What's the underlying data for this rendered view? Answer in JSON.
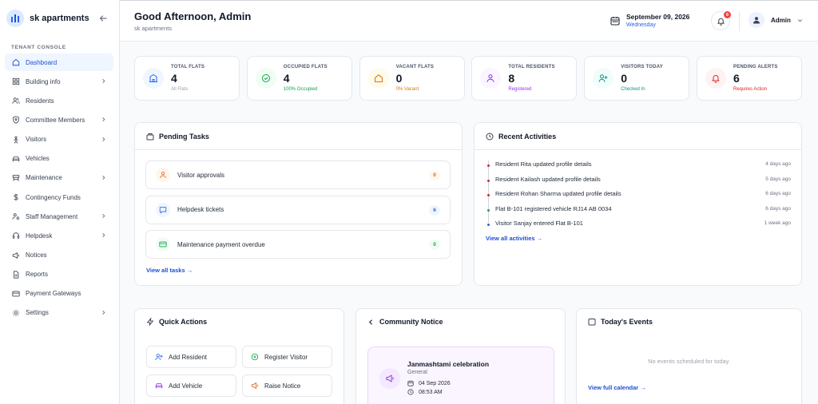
{
  "brand": {
    "name": "sk apartments"
  },
  "sidebar": {
    "section_label": "TENANT CONSOLE",
    "items": [
      {
        "label": "Dashboard",
        "icon": "home-icon",
        "chevron": false,
        "active": true
      },
      {
        "label": "Building info",
        "icon": "grid-icon",
        "chevron": true
      },
      {
        "label": "Residents",
        "icon": "users-icon",
        "chevron": false
      },
      {
        "label": "Committee Members",
        "icon": "shield-icon",
        "chevron": true
      },
      {
        "label": "Visitors",
        "icon": "user-walk-icon",
        "chevron": true
      },
      {
        "label": "Vehicles",
        "icon": "car-icon",
        "chevron": false
      },
      {
        "label": "Maintenance",
        "icon": "wrench-icon",
        "chevron": true
      },
      {
        "label": "Contingency Funds",
        "icon": "dollar-icon",
        "chevron": false
      },
      {
        "label": "Staff Management",
        "icon": "staff-icon",
        "chevron": true
      },
      {
        "label": "Helpdesk",
        "icon": "headset-icon",
        "chevron": true
      },
      {
        "label": "Notices",
        "icon": "megaphone-icon",
        "chevron": false
      },
      {
        "label": "Reports",
        "icon": "file-icon",
        "chevron": false
      },
      {
        "label": "Payment Gateways",
        "icon": "card-icon",
        "chevron": false
      },
      {
        "label": "Settings",
        "icon": "gear-icon",
        "chevron": true
      }
    ]
  },
  "header": {
    "greeting": "Good Afternoon, Admin",
    "subtitle": "sk apartments",
    "date": "September 09, 2026",
    "weekday": "Wednesday",
    "notification_count": "6",
    "user": "Admin"
  },
  "stats": [
    {
      "label": "TOTAL FLATS",
      "value": "4",
      "sub": "All Flats",
      "icon": "building-icon",
      "color": "#2563eb",
      "sub_color": "#9ca3af",
      "bg": "#eff6ff"
    },
    {
      "label": "OCCUPIED FLATS",
      "value": "4",
      "sub": "100% Occupied",
      "icon": "check-circle-icon",
      "color": "#16a34a",
      "sub_color": "#16a34a",
      "bg": "#f0fdf4"
    },
    {
      "label": "VACANT FLATS",
      "value": "0",
      "sub": "0% Vacant",
      "icon": "home-icon",
      "color": "#d97706",
      "sub_color": "#d97706",
      "bg": "#fffbeb"
    },
    {
      "label": "TOTAL RESIDENTS",
      "value": "8",
      "sub": "Registered",
      "icon": "user-icon",
      "color": "#9333ea",
      "sub_color": "#9333ea",
      "bg": "#faf5ff"
    },
    {
      "label": "VISITORS TODAY",
      "value": "0",
      "sub": "Checked In",
      "icon": "user-plus-icon",
      "color": "#0d9488",
      "sub_color": "#0d9488",
      "bg": "#f0fdfa"
    },
    {
      "label": "PENDING ALERTS",
      "value": "6",
      "sub": "Requires Action",
      "icon": "bell-icon",
      "color": "#dc2626",
      "sub_color": "#dc2626",
      "bg": "#fef2f2"
    }
  ],
  "pending_tasks": {
    "title": "Pending Tasks",
    "items": [
      {
        "label": "Visitor approvals",
        "count": "0",
        "icon": "user-icon",
        "color": "#ea580c",
        "bg": "#fff7ed"
      },
      {
        "label": "Helpdesk tickets",
        "count": "6",
        "icon": "chat-icon",
        "color": "#2563eb",
        "bg": "#eff6ff"
      },
      {
        "label": "Maintenance payment overdue",
        "count": "0",
        "icon": "card-icon",
        "color": "#16a34a",
        "bg": "#f0fdf4"
      }
    ],
    "link": "View all tasks →"
  },
  "recent_activities": {
    "title": "Recent Activities",
    "items": [
      {
        "text": "Resident Rita updated profile details",
        "time": "4 days ago",
        "color": "#dc2626"
      },
      {
        "text": "Resident Kailash updated profile details",
        "time": "5 days ago",
        "color": "#dc2626"
      },
      {
        "text": "Resident Rohan Sharma updated profile details",
        "time": "6 days ago",
        "color": "#dc2626"
      },
      {
        "text": "Flat B-101 registered vehicle RJ14 AB 0034",
        "time": "6 days ago",
        "color": "#16a34a"
      },
      {
        "text": "Visitor Sanjay entered Flat B-101",
        "time": "1 week ago",
        "color": "#2563eb"
      }
    ],
    "link": "View all activities →"
  },
  "quick_actions": {
    "title": "Quick Actions",
    "items": [
      {
        "label": "Add Resident",
        "icon": "user-plus-icon",
        "color": "#2563eb"
      },
      {
        "label": "Register Visitor",
        "icon": "plus-circle-icon",
        "color": "#16a34a"
      },
      {
        "label": "Add Vehicle",
        "icon": "car-icon",
        "color": "#9333ea"
      },
      {
        "label": "Raise Notice",
        "icon": "megaphone-icon",
        "color": "#ea580c"
      }
    ]
  },
  "community_notice": {
    "title": "Community Notice",
    "notice_title": "Janmashtami celebration",
    "category": "General",
    "date": "04 Sep 2026",
    "time": "08:53 AM"
  },
  "todays_events": {
    "title": "Today's Events",
    "empty": "No events scheduled for today.",
    "link": "View full calendar →"
  }
}
